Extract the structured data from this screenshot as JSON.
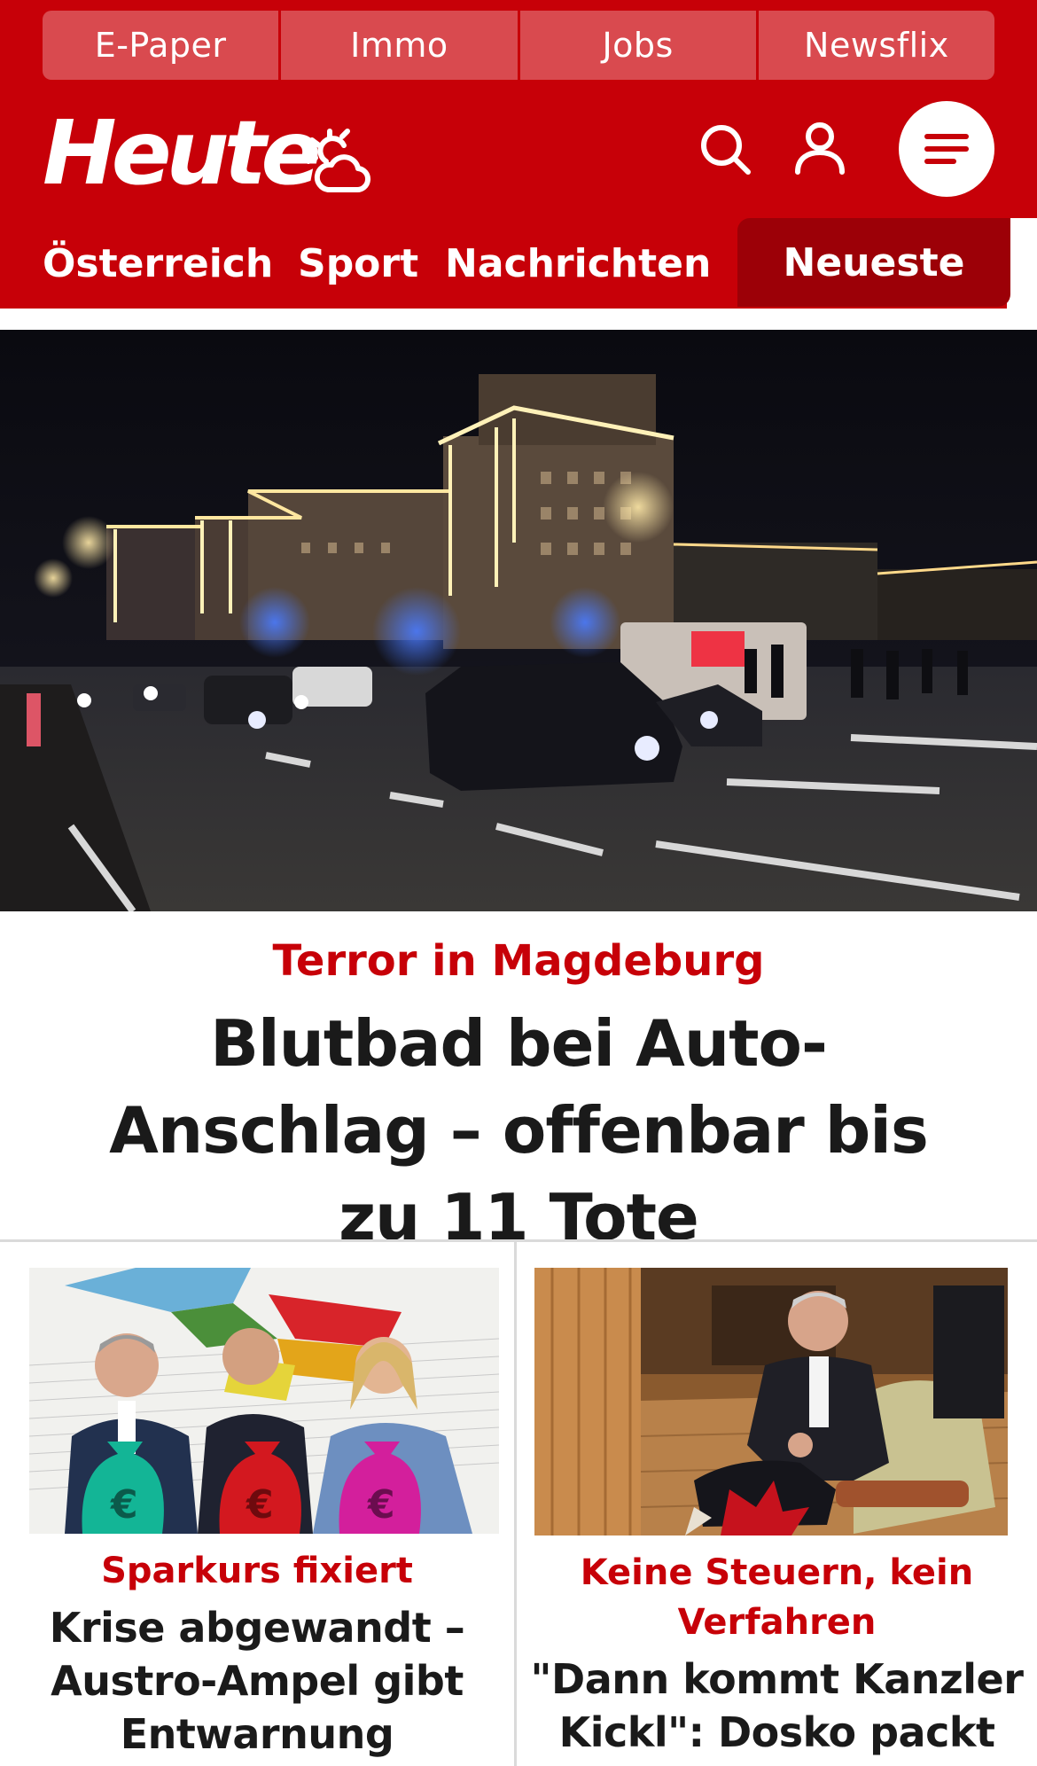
{
  "brand": {
    "name": "Heute",
    "accent_color": "#c70008",
    "dark_accent_color": "#9c0007"
  },
  "service_bar": {
    "items": [
      "E-Paper",
      "Immo",
      "Jobs",
      "Newsflix"
    ]
  },
  "header": {
    "icons": [
      "weather-icon",
      "search-icon",
      "user-icon",
      "menu-icon"
    ]
  },
  "nav": {
    "items": [
      "Österreich",
      "Sport",
      "Nachrichten"
    ],
    "active_label": "Neueste"
  },
  "hero": {
    "kicker": "Terror in Magdeburg",
    "headline": "Blutbad bei Auto-Anschlag – offenbar bis zu 11 Tote"
  },
  "teasers": [
    {
      "kicker": "Sparkurs fixiert",
      "headline": "Krise abgewandt – Austro-Ampel gibt Entwarnung"
    },
    {
      "kicker": "Keine Steuern, kein Verfahren",
      "headline": "\"Dann kommt Kanzler Kickl\": Dosko packt"
    }
  ]
}
